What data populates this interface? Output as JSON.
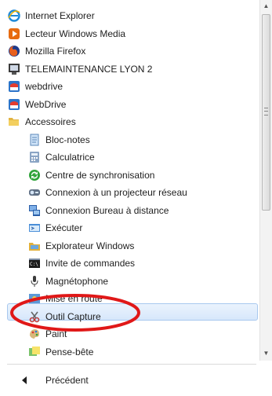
{
  "programs": {
    "items": [
      {
        "label": "Internet Explorer",
        "icon": "internet-explorer-icon",
        "level": 0
      },
      {
        "label": "Lecteur Windows Media",
        "icon": "windows-media-player-icon",
        "level": 0
      },
      {
        "label": "Mozilla Firefox",
        "icon": "firefox-icon",
        "level": 0
      },
      {
        "label": "TELEMAINTENANCE LYON 2",
        "icon": "remote-maintenance-icon",
        "level": 0
      },
      {
        "label": "webdrive",
        "icon": "webdrive-icon",
        "level": 0
      },
      {
        "label": "WebDrive",
        "icon": "webdrive-icon",
        "level": 0
      },
      {
        "label": "Accessoires",
        "icon": "folder-icon",
        "level": 0
      },
      {
        "label": "Bloc-notes",
        "icon": "notepad-icon",
        "level": 1
      },
      {
        "label": "Calculatrice",
        "icon": "calculator-icon",
        "level": 1
      },
      {
        "label": "Centre de synchronisation",
        "icon": "sync-center-icon",
        "level": 1
      },
      {
        "label": "Connexion à un projecteur réseau",
        "icon": "network-projector-icon",
        "level": 1
      },
      {
        "label": "Connexion Bureau à distance",
        "icon": "remote-desktop-icon",
        "level": 1
      },
      {
        "label": "Exécuter",
        "icon": "run-icon",
        "level": 1
      },
      {
        "label": "Explorateur Windows",
        "icon": "windows-explorer-icon",
        "level": 1
      },
      {
        "label": "Invite de commandes",
        "icon": "command-prompt-icon",
        "level": 1
      },
      {
        "label": "Magnétophone",
        "icon": "microphone-icon",
        "level": 1
      },
      {
        "label": "Mise en route",
        "icon": "getting-started-icon",
        "level": 1
      },
      {
        "label": "Outil Capture",
        "icon": "snipping-tool-icon",
        "level": 1
      },
      {
        "label": "Paint",
        "icon": "paint-icon",
        "level": 1
      },
      {
        "label": "Pense-bête",
        "icon": "sticky-notes-icon",
        "level": 1
      }
    ],
    "selected_label": "Outil Capture"
  },
  "footer": {
    "back_label": "Précédent",
    "back_icon": "back-arrow-icon"
  },
  "colors": {
    "selection_fill": "#dbe9fb",
    "annotation_ellipse": "#e01818"
  }
}
